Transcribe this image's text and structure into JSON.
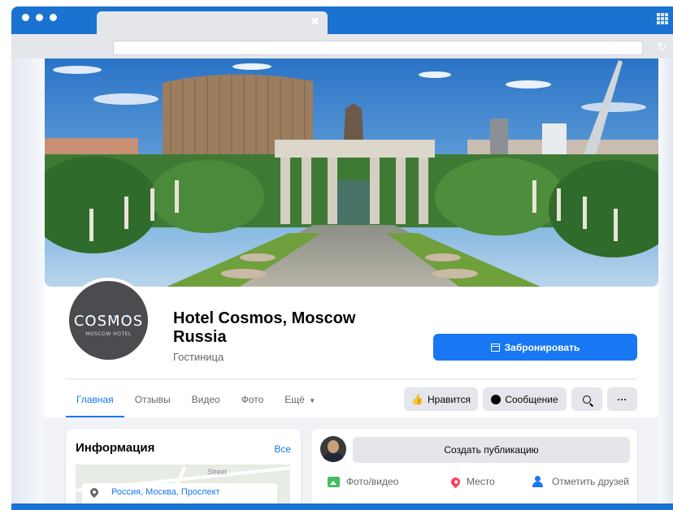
{
  "page": {
    "name": "Hotel Cosmos, Moscow Russia",
    "category": "Гостиница"
  },
  "logo": {
    "text": "COSMOS",
    "subtext": "MOSCOW HOTEL"
  },
  "buttons": {
    "book": "Забронировать",
    "like": "Нравится",
    "message": "Сообщение",
    "more": "···"
  },
  "nav": {
    "tabs": [
      {
        "label": "Главная",
        "active": true
      },
      {
        "label": "Отзывы"
      },
      {
        "label": "Видео"
      },
      {
        "label": "Фото"
      },
      {
        "label": "Ещё"
      }
    ]
  },
  "info": {
    "title": "Информация",
    "see_all": "Все",
    "map_street": "Street",
    "address": "Россия, Москва, Проспект"
  },
  "composer": {
    "create_post": "Создать публикацию",
    "photo_video": "Фото/видео",
    "place": "Место",
    "tag_friends": "Отметить друзей"
  },
  "colors": {
    "accent": "#1877f2",
    "chrome": "#1a73d0"
  }
}
